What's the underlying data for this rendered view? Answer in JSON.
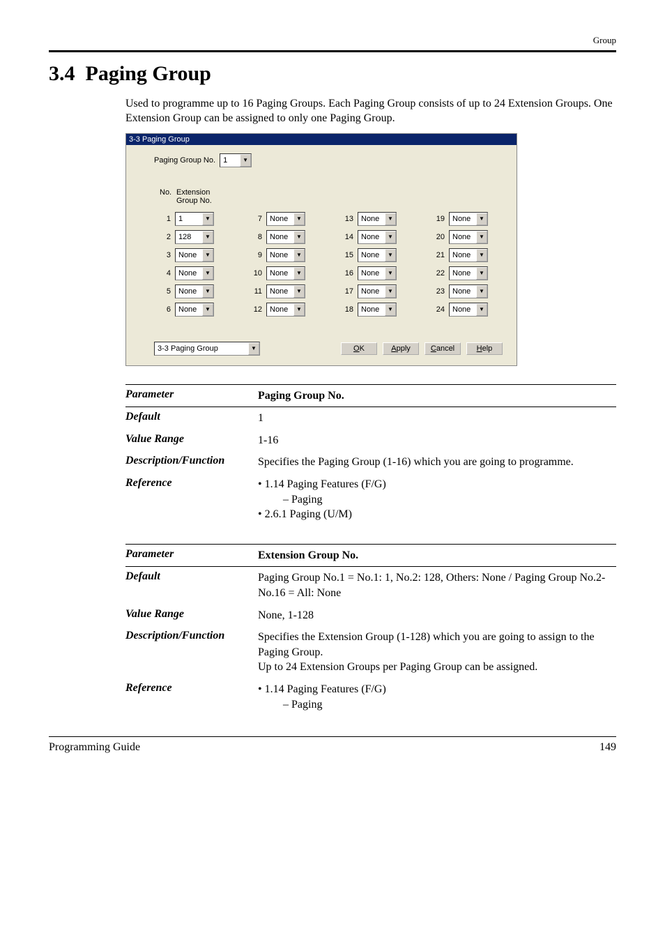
{
  "header": {
    "category": "Group"
  },
  "section": {
    "number": "3.4",
    "title": "Paging Group",
    "intro": "Used to programme up to 16 Paging Groups. Each Paging Group consists of up to 24 Extension Groups. One Extension Group can be assigned to only one Paging Group."
  },
  "screenshot": {
    "titlebar": "3-3 Paging Group",
    "paging_label": "Paging Group No.",
    "paging_value": "1",
    "col_no": "No.",
    "col_ext": "Extension\nGroup No.",
    "rows": [
      {
        "n": "1",
        "v": "1"
      },
      {
        "n": "2",
        "v": "128"
      },
      {
        "n": "3",
        "v": "None"
      },
      {
        "n": "4",
        "v": "None"
      },
      {
        "n": "5",
        "v": "None"
      },
      {
        "n": "6",
        "v": "None"
      },
      {
        "n": "7",
        "v": "None"
      },
      {
        "n": "8",
        "v": "None"
      },
      {
        "n": "9",
        "v": "None"
      },
      {
        "n": "10",
        "v": "None"
      },
      {
        "n": "11",
        "v": "None"
      },
      {
        "n": "12",
        "v": "None"
      },
      {
        "n": "13",
        "v": "None"
      },
      {
        "n": "14",
        "v": "None"
      },
      {
        "n": "15",
        "v": "None"
      },
      {
        "n": "16",
        "v": "None"
      },
      {
        "n": "17",
        "v": "None"
      },
      {
        "n": "18",
        "v": "None"
      },
      {
        "n": "19",
        "v": "None"
      },
      {
        "n": "20",
        "v": "None"
      },
      {
        "n": "21",
        "v": "None"
      },
      {
        "n": "22",
        "v": "None"
      },
      {
        "n": "23",
        "v": "None"
      },
      {
        "n": "24",
        "v": "None"
      }
    ],
    "jump": "3-3 Paging Group",
    "buttons": {
      "ok": "OK",
      "apply": "Apply",
      "cancel": "Cancel",
      "help": "Help"
    }
  },
  "param1": {
    "parameter_label": "Parameter",
    "parameter_value": "Paging Group No.",
    "default_label": "Default",
    "default_value": "1",
    "range_label": "Value Range",
    "range_value": "1-16",
    "desc_label": "Description/Function",
    "desc_value": "Specifies the Paging Group (1-16) which you are going to programme.",
    "ref_label": "Reference",
    "ref_line1": "• 1.14 Paging Features (F/G)",
    "ref_line2": "– Paging",
    "ref_line3": "• 2.6.1 Paging (U/M)"
  },
  "param2": {
    "parameter_label": "Parameter",
    "parameter_value": "Extension Group No.",
    "default_label": "Default",
    "default_value": "Paging Group No.1 = No.1: 1, No.2: 128, Others: None / Paging Group No.2-No.16 = All: None",
    "range_label": "Value Range",
    "range_value": "None, 1-128",
    "desc_label": "Description/Function",
    "desc_line1": "Specifies the Extension Group (1-128) which you are going to assign to the Paging Group.",
    "desc_line2": "Up to 24 Extension Groups per Paging Group can be assigned.",
    "ref_label": "Reference",
    "ref_line1": "• 1.14 Paging Features (F/G)",
    "ref_line2": "– Paging"
  },
  "footer": {
    "left": "Programming Guide",
    "right": "149"
  }
}
